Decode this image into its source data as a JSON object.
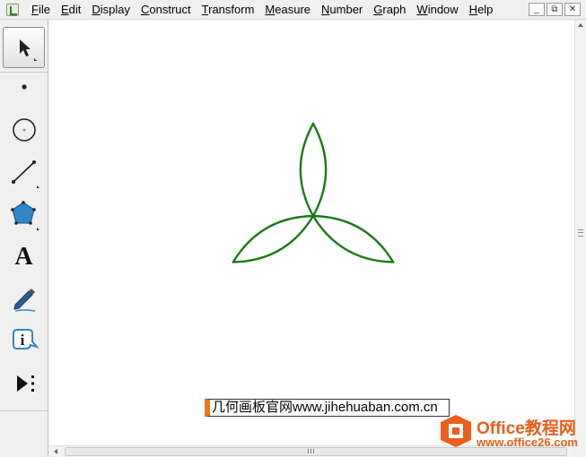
{
  "menubar": {
    "items": [
      {
        "pre": "",
        "key": "F",
        "post": "ile"
      },
      {
        "pre": "",
        "key": "E",
        "post": "dit"
      },
      {
        "pre": "",
        "key": "D",
        "post": "isplay"
      },
      {
        "pre": "",
        "key": "C",
        "post": "onstruct"
      },
      {
        "pre": "",
        "key": "T",
        "post": "ransform"
      },
      {
        "pre": "",
        "key": "M",
        "post": "easure"
      },
      {
        "pre": "",
        "key": "N",
        "post": "umber"
      },
      {
        "pre": "",
        "key": "G",
        "post": "raph"
      },
      {
        "pre": "",
        "key": "W",
        "post": "indow"
      },
      {
        "pre": "",
        "key": "H",
        "post": "elp"
      }
    ],
    "window_controls": {
      "minimize": "_",
      "restore": "⧉",
      "close": "✕"
    }
  },
  "toolbox": {
    "tools": [
      {
        "name": "arrow-tool",
        "icon": "arrow-icon",
        "selected": true
      },
      {
        "name": "point-tool",
        "icon": "point-icon"
      },
      {
        "name": "compass-tool",
        "icon": "compass-icon"
      },
      {
        "name": "straightedge-tool",
        "icon": "line-icon"
      },
      {
        "name": "polygon-tool",
        "icon": "polygon-icon"
      },
      {
        "name": "text-tool",
        "icon": "text-icon",
        "glyph": "A"
      },
      {
        "name": "marker-tool",
        "icon": "marker-icon"
      },
      {
        "name": "information-tool",
        "icon": "info-icon",
        "glyph": "i"
      },
      {
        "name": "custom-tool",
        "icon": "custom-tools-icon"
      }
    ]
  },
  "drawing": {
    "stroke_color": "#1a7a1a",
    "shape": "three-petal-arc-figure"
  },
  "caption": {
    "text": "几何画板官网www.jihehuaban.com.cn"
  },
  "watermark": {
    "title": "Office教程网",
    "url": "www.office26.com",
    "color": "#e8601c"
  }
}
